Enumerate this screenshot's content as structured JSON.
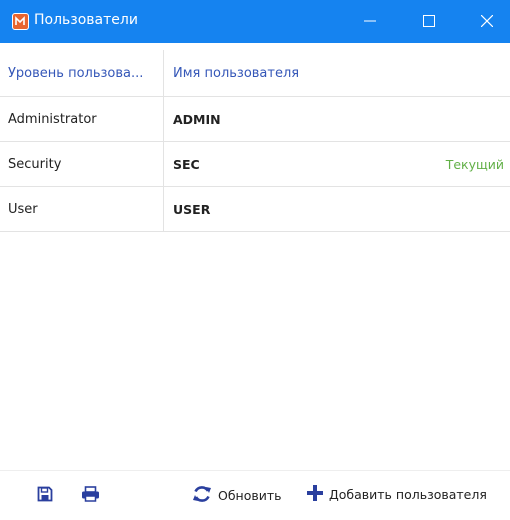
{
  "window": {
    "title": "Пользователи",
    "accent_color": "#1583f0",
    "icons": [
      "app-icon",
      "minimize-icon",
      "maximize-icon",
      "close-icon"
    ]
  },
  "table": {
    "columns": [
      "Уровень пользова...",
      "Имя пользователя"
    ],
    "rows": [
      {
        "level": "Administrator",
        "name": "ADMIN",
        "status": ""
      },
      {
        "level": "Security",
        "name": "SEC",
        "status": "Текущий"
      },
      {
        "level": "User",
        "name": "USER",
        "status": ""
      }
    ],
    "status_color": "#62b047"
  },
  "footer": {
    "icons": [
      "save-icon",
      "print-icon"
    ],
    "refresh_label": "Обновить",
    "add_user_label": "Добавить пользователя"
  }
}
